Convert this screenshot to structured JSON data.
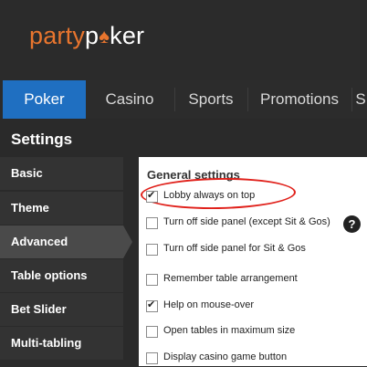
{
  "brand": {
    "logo_text_1": "party",
    "logo_text_2": "p",
    "logo_text_3": "ker",
    "spade_glyph": "♠",
    "accent": "#e8752e"
  },
  "nav": {
    "tabs": [
      {
        "label": "Poker",
        "active": true
      },
      {
        "label": "Casino"
      },
      {
        "label": "Sports"
      },
      {
        "label": "Promotions"
      },
      {
        "label": "S"
      }
    ]
  },
  "settings": {
    "title": "Settings"
  },
  "sidebar": {
    "items": [
      {
        "label": "Basic"
      },
      {
        "label": "Theme"
      },
      {
        "label": "Advanced",
        "active": true
      },
      {
        "label": "Table options"
      },
      {
        "label": "Bet Slider"
      },
      {
        "label": "Multi-tabling"
      }
    ]
  },
  "general": {
    "title": "General settings",
    "options": [
      {
        "label": "Lobby always on top",
        "checked": true
      },
      {
        "label": "Turn off side panel (except Sit & Gos)",
        "checked": false
      },
      {
        "label": "Turn off side panel for Sit & Gos",
        "checked": false
      },
      {
        "label": "Remember table arrangement",
        "checked": false
      },
      {
        "label": "Help on mouse-over",
        "checked": true
      },
      {
        "label": "Open tables in maximum size",
        "checked": false
      },
      {
        "label": "Display casino game button",
        "checked": false
      }
    ],
    "help_glyph": "?"
  }
}
